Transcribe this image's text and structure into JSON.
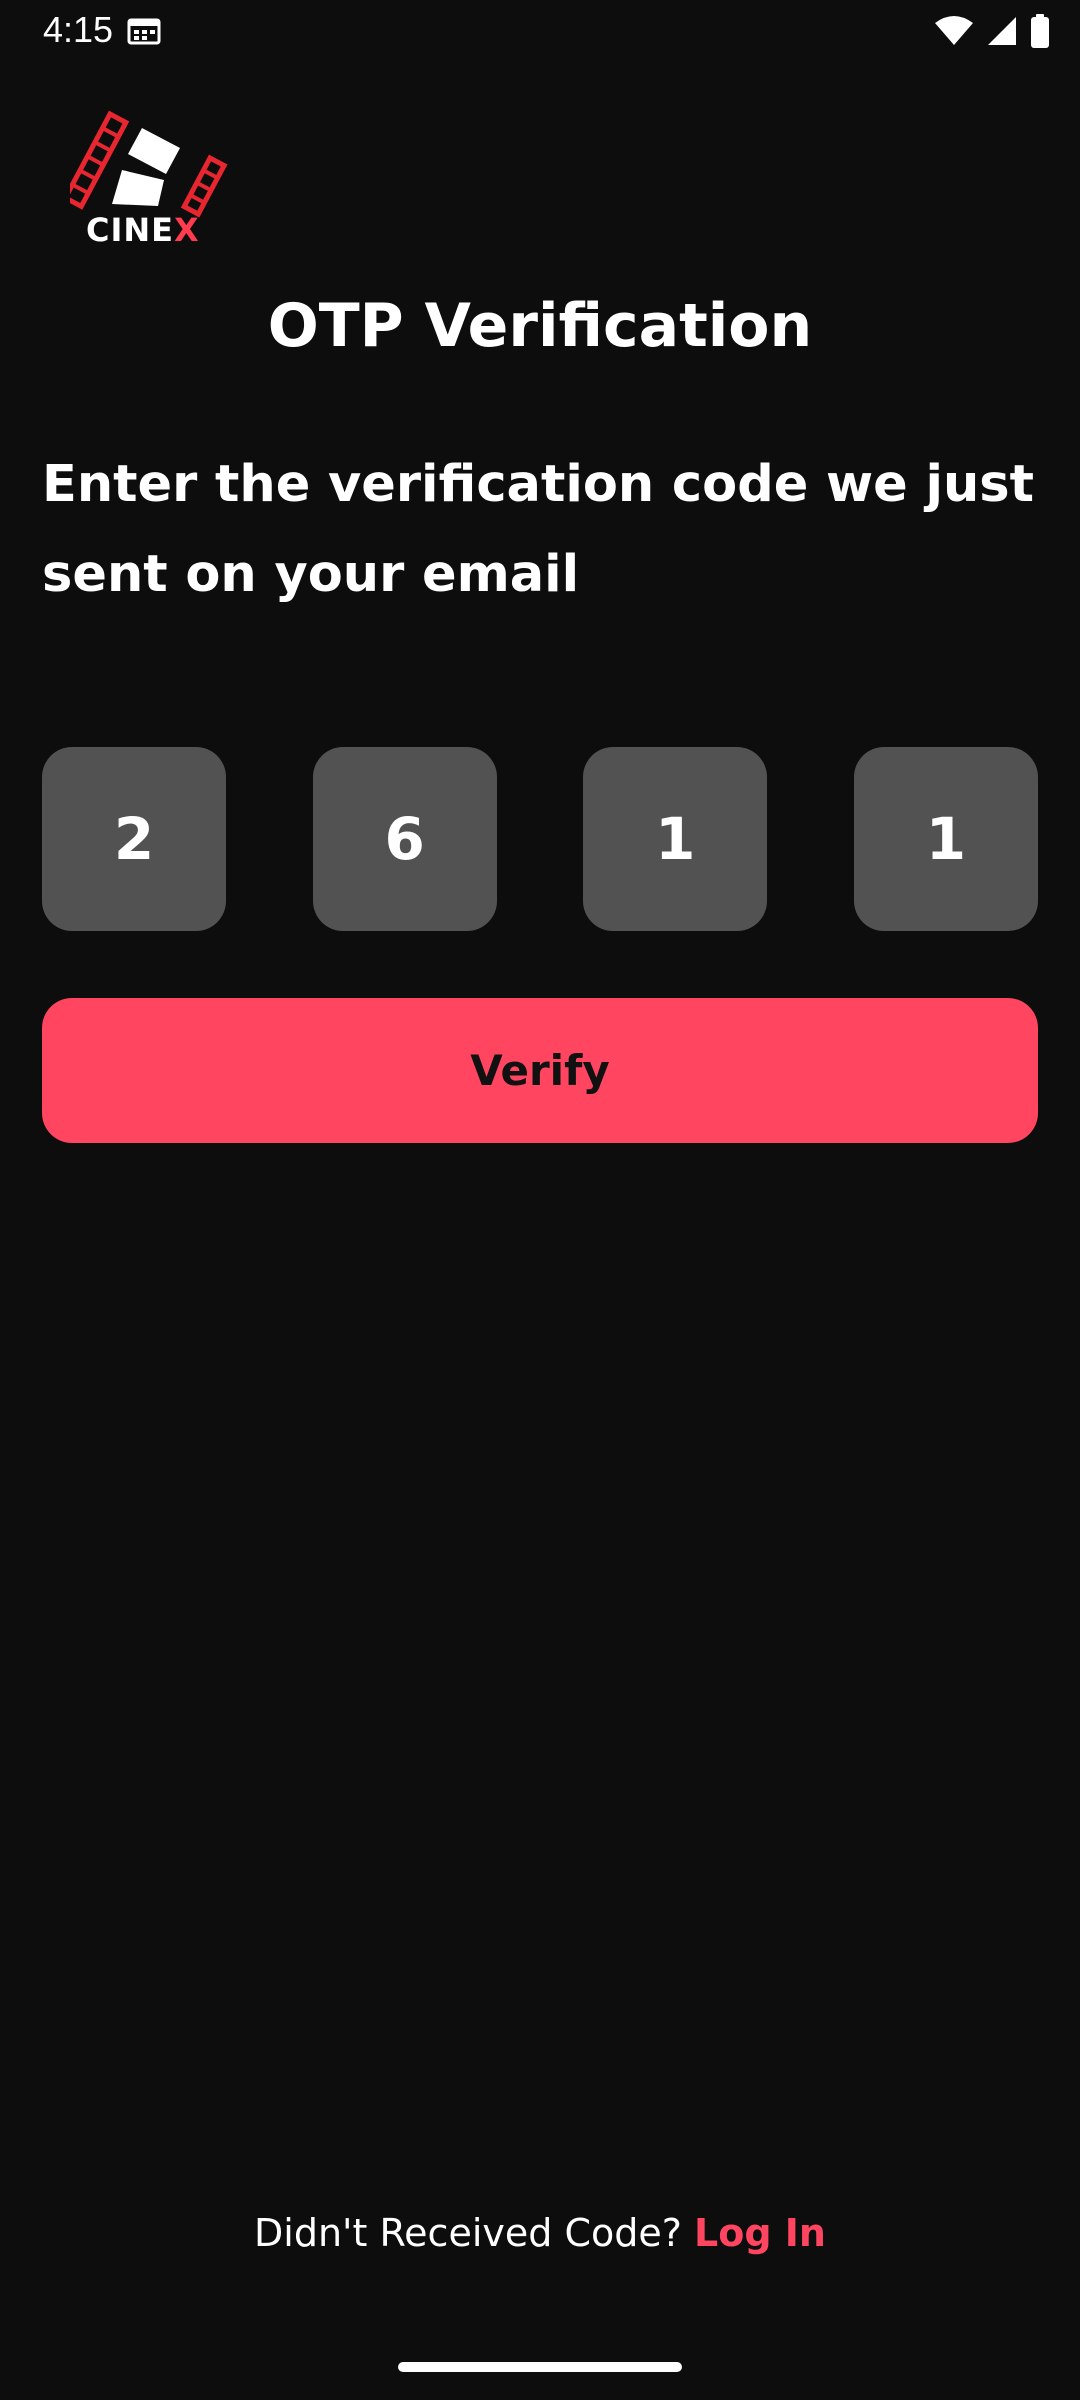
{
  "status_bar": {
    "time": "4:15",
    "icons": [
      "calendar-icon",
      "wifi-icon",
      "signal-icon",
      "battery-icon"
    ]
  },
  "logo": {
    "text_white": "CINE",
    "text_red": "X",
    "accent_color": "#e8262f"
  },
  "header": {
    "title": "OTP Verification"
  },
  "instructions": "Enter the verification code we just sent on your email",
  "otp": {
    "digits": [
      "2",
      "6",
      "1",
      "1"
    ]
  },
  "verify_button": {
    "label": "Verify",
    "color": "#ff4560"
  },
  "footer": {
    "question": "Didn't Received Code?",
    "link_label": "Log In",
    "link_color": "#ff4560"
  },
  "colors": {
    "background": "#0d0d0e",
    "otp_box": "#525252"
  }
}
